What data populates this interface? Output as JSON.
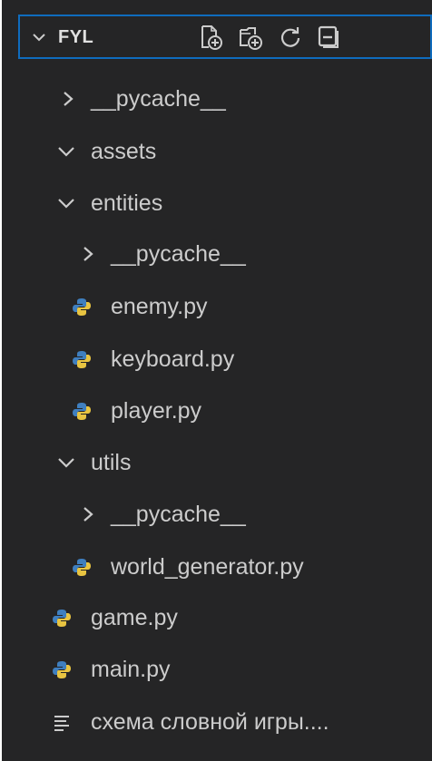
{
  "explorer": {
    "title": "FYL",
    "actions": {
      "new_file": "new-file-icon",
      "new_folder": "new-folder-icon",
      "refresh": "refresh-icon",
      "collapse": "collapse-all-icon"
    }
  },
  "tree": [
    {
      "label": "__pycache__",
      "type": "folder",
      "expanded": false
    },
    {
      "label": "assets",
      "type": "folder",
      "expanded": true
    },
    {
      "label": "entities",
      "type": "folder",
      "expanded": true
    },
    {
      "label": "__pycache__",
      "type": "folder",
      "expanded": false
    },
    {
      "label": "enemy.py",
      "type": "python"
    },
    {
      "label": "keyboard.py",
      "type": "python"
    },
    {
      "label": "player.py",
      "type": "python"
    },
    {
      "label": "utils",
      "type": "folder",
      "expanded": true
    },
    {
      "label": "__pycache__",
      "type": "folder",
      "expanded": false
    },
    {
      "label": "world_generator.py",
      "type": "python"
    },
    {
      "label": "game.py",
      "type": "python"
    },
    {
      "label": "main.py",
      "type": "python"
    },
    {
      "label": "схема словной игры....",
      "type": "text"
    }
  ],
  "colors": {
    "background": "#252526",
    "focus_border": "#0f6cbd",
    "text": "#cccccc",
    "python_icon_blue": "#3f7fbf",
    "python_icon_yellow": "#e8c441"
  }
}
